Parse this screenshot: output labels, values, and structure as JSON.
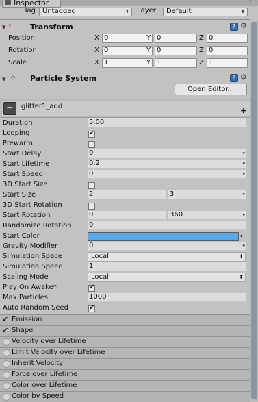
{
  "window": {
    "tab_label": "Inspector"
  },
  "header": {
    "tag_label": "Tag",
    "tag_value": "Untagged",
    "layer_label": "Layer",
    "layer_value": "Default"
  },
  "transform": {
    "title": "Transform",
    "rows": [
      {
        "label": "Position",
        "x": "0",
        "y": "0",
        "z": "0"
      },
      {
        "label": "Rotation",
        "x": "0",
        "y": "0",
        "z": "0"
      },
      {
        "label": "Scale",
        "x": "1",
        "y": "1",
        "z": "1"
      }
    ],
    "axes": [
      "X",
      "Y",
      "Z"
    ]
  },
  "particle_system": {
    "title": "Particle System",
    "open_editor_label": "Open Editor...",
    "system_name": "glitter1_add",
    "add_label": "+",
    "props": {
      "duration": {
        "label": "Duration",
        "value": "5.00"
      },
      "looping": {
        "label": "Looping",
        "checked": true
      },
      "prewarm": {
        "label": "Prewarm",
        "checked": false
      },
      "start_delay": {
        "label": "Start Delay",
        "value": "0"
      },
      "start_lifetime": {
        "label": "Start Lifetime",
        "value": "0.2"
      },
      "start_speed": {
        "label": "Start Speed",
        "value": "0"
      },
      "three_d_start_size": {
        "label": "3D Start Size",
        "checked": false
      },
      "start_size": {
        "label": "Start Size",
        "min": "2",
        "max": "3"
      },
      "three_d_start_rotation": {
        "label": "3D Start Rotation",
        "checked": false
      },
      "start_rotation": {
        "label": "Start Rotation",
        "min": "0",
        "max": "360"
      },
      "randomize_rotation": {
        "label": "Randomize Rotation",
        "value": "0"
      },
      "start_color": {
        "label": "Start Color",
        "color": "#58a8e8"
      },
      "gravity_modifier": {
        "label": "Gravity Modifier",
        "value": "0"
      },
      "simulation_space": {
        "label": "Simulation Space",
        "value": "Local"
      },
      "simulation_speed": {
        "label": "Simulation Speed",
        "value": "1"
      },
      "scaling_mode": {
        "label": "Scaling Mode",
        "value": "Local"
      },
      "play_on_awake": {
        "label": "Play On Awake*",
        "checked": true
      },
      "max_particles": {
        "label": "Max Particles",
        "value": "1000"
      },
      "auto_random_seed": {
        "label": "Auto Random Seed",
        "checked": true
      }
    },
    "modules": [
      {
        "label": "Emission",
        "enabled": true
      },
      {
        "label": "Shape",
        "enabled": true
      },
      {
        "label": "Velocity over Lifetime",
        "enabled": false
      },
      {
        "label": "Limit Velocity over Lifetime",
        "enabled": false
      },
      {
        "label": "Inherit Velocity",
        "enabled": false
      },
      {
        "label": "Force over Lifetime",
        "enabled": false
      },
      {
        "label": "Color over Lifetime",
        "enabled": false
      },
      {
        "label": "Color by Speed",
        "enabled": false
      }
    ]
  },
  "icons": {
    "help": "help-icon",
    "gear": "gear-icon",
    "check_mark": "✔",
    "dropdown_arrow": "▾",
    "stepper_arrow": "⬍",
    "fold_arrow": "▼"
  }
}
